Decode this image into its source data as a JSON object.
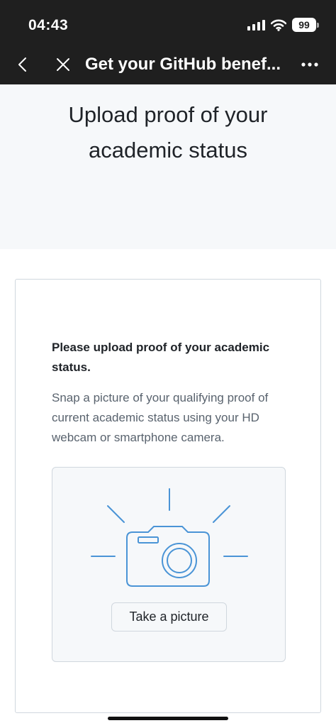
{
  "status_bar": {
    "time": "04:43",
    "battery": "99",
    "icons": [
      "cellular-signal-icon",
      "wifi-icon",
      "battery-icon"
    ]
  },
  "nav": {
    "title": "Get your GitHub benef...",
    "icons": [
      "chevron-left-icon",
      "close-icon",
      "more-icon"
    ]
  },
  "page": {
    "title": "Upload proof of your academic status"
  },
  "card": {
    "heading": "Please upload proof of your academic status.",
    "description": "Snap a picture of your qualifying proof of current academic status using your HD webcam or smartphone camera.",
    "button_label": "Take a picture",
    "illustration_icon": "camera-icon"
  },
  "colors": {
    "app_bar": "#1f1f1f",
    "header_bg": "#f6f8fa",
    "accent_blue": "#4a94d6",
    "text_primary": "#1f2328",
    "text_muted": "#59636e",
    "border": "#d0d7de"
  }
}
